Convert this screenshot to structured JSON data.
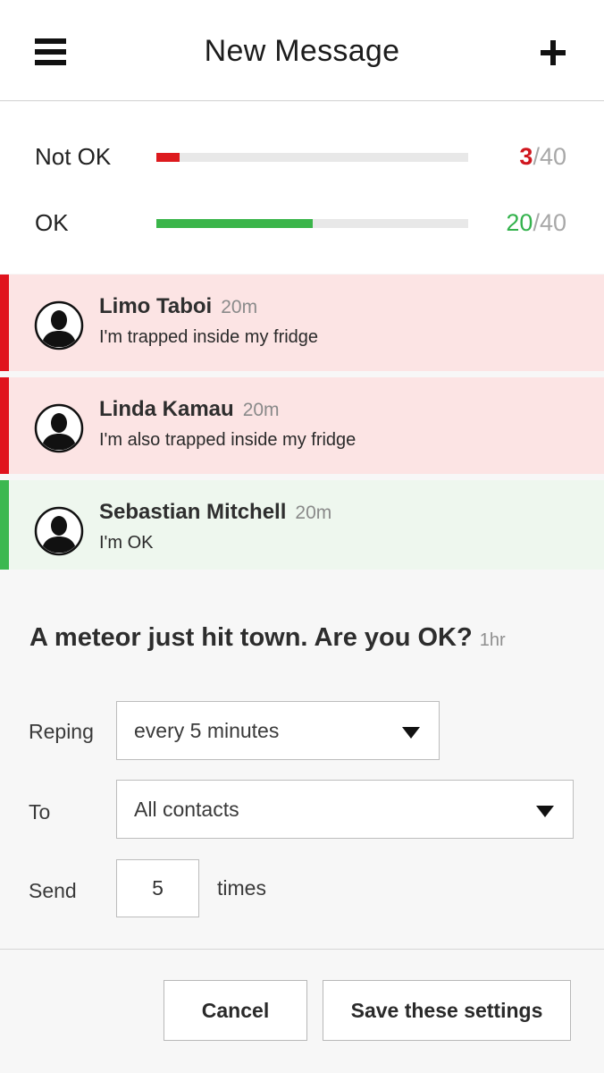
{
  "header": {
    "title": "New Message",
    "menu_icon": "hamburger-menu-icon",
    "add_icon": "plus-icon"
  },
  "stats": {
    "not_ok": {
      "label": "Not OK",
      "count": "3",
      "total": "/40",
      "value": 3,
      "max": 40,
      "color": "#dd1a1e"
    },
    "ok": {
      "label": "OK",
      "count": "20",
      "total": "/40",
      "value": 20,
      "max": 40,
      "color": "#3ab54a"
    }
  },
  "responses": [
    {
      "name": "Limo Taboi",
      "time": "20m",
      "message": "I'm trapped inside my fridge",
      "status": "not_ok"
    },
    {
      "name": "Linda Kamau",
      "time": "20m",
      "message": "I'm also trapped inside my fridge",
      "status": "not_ok"
    },
    {
      "name": "Sebastian Mitchell",
      "time": "20m",
      "message": "I'm OK",
      "status": "ok"
    }
  ],
  "question": {
    "text": "A meteor just hit town. Are you OK?",
    "time": "1hr"
  },
  "form": {
    "reping": {
      "label": "Reping",
      "value": "every 5 minutes"
    },
    "to": {
      "label": "To",
      "value": "All contacts"
    },
    "send": {
      "label": "Send",
      "value": "5",
      "suffix": "times"
    }
  },
  "buttons": {
    "cancel": "Cancel",
    "save": "Save these settings"
  }
}
